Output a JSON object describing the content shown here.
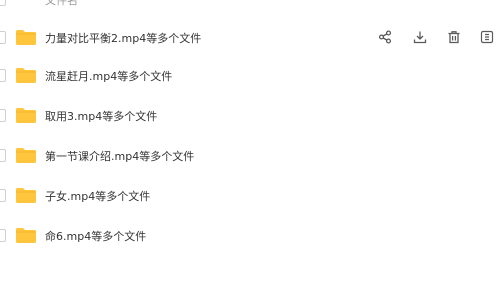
{
  "header": {
    "column_label": "文件名"
  },
  "rows": [
    {
      "name": "力量对比平衡2.mp4等多个文件"
    },
    {
      "name": "流星赶月.mp4等多个文件"
    },
    {
      "name": "取用3.mp4等多个文件"
    },
    {
      "name": "第一节课介绍.mp4等多个文件"
    },
    {
      "name": "子女.mp4等多个文件"
    },
    {
      "name": "命6.mp4等多个文件"
    }
  ],
  "row_actions": {
    "icons": [
      "share-icon",
      "download-icon",
      "delete-icon",
      "more-icon"
    ]
  },
  "colors": {
    "folder": "#FFC53D",
    "folder_dark": "#F5B21F",
    "icon": "#5a5a5a"
  }
}
